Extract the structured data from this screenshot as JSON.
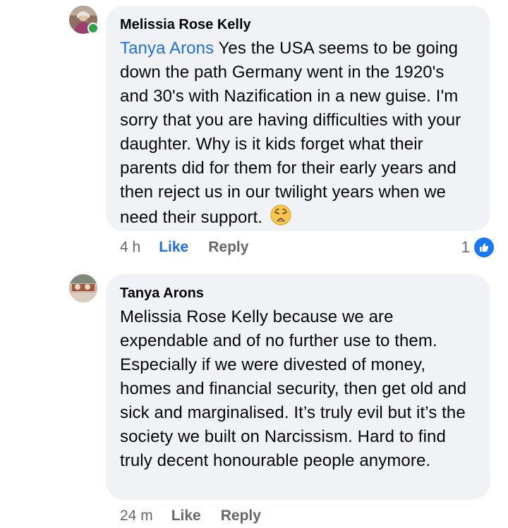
{
  "comments": [
    {
      "author": "Melissia Rose Kelly",
      "mention": "Tanya Arons",
      "text": " Yes the USA seems to be going down the path Germany went in the 1920's and 30's with Nazification in a new guise. I'm sorry that you are having difficulties with your daughter. Why is it kids forget what their parents did for them for their early years and then reject us in our twilight years when we need their support. ",
      "emoji": "weary-face-emoji",
      "time": "4 h",
      "like_label": "Like",
      "reply_label": "Reply",
      "reaction_count": "1",
      "reaction_icon": "like-badge-icon",
      "online": true
    },
    {
      "author": "Tanya Arons",
      "text": "Melissia Rose Kelly because we are expendable and of no further use to them. Especially if we were divested of money, homes and financial security, then get old and sick and marginalised. It’s truly evil but it’s the society we built on Narcissism.  Hard to find truly decent honourable people anymore.",
      "time": "24 m",
      "like_label": "Like",
      "reply_label": "Reply"
    }
  ],
  "colors": {
    "accent": "#216fdb",
    "bubble": "#f0f2f5",
    "meta": "#65676b",
    "online": "#31a24c"
  }
}
